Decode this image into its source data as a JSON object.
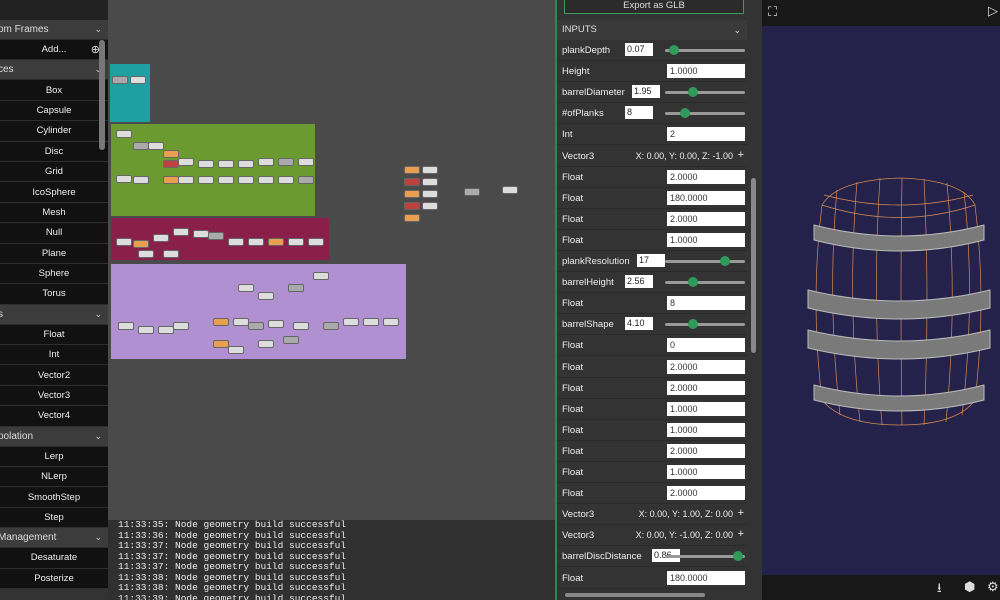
{
  "sidebar": {
    "sections": [
      {
        "title": "om Frames",
        "items": [
          {
            "label": "Add...",
            "icon": "plus-circle-icon"
          }
        ]
      },
      {
        "title": "ces",
        "items": [
          {
            "label": "Box"
          },
          {
            "label": "Capsule"
          },
          {
            "label": "Cylinder"
          },
          {
            "label": "Disc"
          },
          {
            "label": "Grid"
          },
          {
            "label": "IcoSphere"
          },
          {
            "label": "Mesh"
          },
          {
            "label": "Null"
          },
          {
            "label": "Plane"
          },
          {
            "label": "Sphere"
          },
          {
            "label": "Torus"
          }
        ]
      },
      {
        "title": "s",
        "items": [
          {
            "label": "Float"
          },
          {
            "label": "Int"
          },
          {
            "label": "Vector2"
          },
          {
            "label": "Vector3"
          },
          {
            "label": "Vector4"
          }
        ]
      },
      {
        "title": "polation",
        "items": [
          {
            "label": "Lerp"
          },
          {
            "label": "NLerp"
          },
          {
            "label": "SmoothStep"
          },
          {
            "label": "Step"
          }
        ]
      },
      {
        "title": "Management",
        "items": [
          {
            "label": "Desaturate"
          },
          {
            "label": "Posterize"
          }
        ]
      }
    ]
  },
  "console": {
    "logs": [
      "11:33:35: Node geometry build successful",
      "11:33:36: Node geometry build successful",
      "11:33:37: Node geometry build successful",
      "11:33:37: Node geometry build successful",
      "11:33:37: Node geometry build successful",
      "11:33:38: Node geometry build successful",
      "11:33:38: Node geometry build successful",
      "11:33:39: Node geometry build successful"
    ]
  },
  "inputs": {
    "export_label": "Export as GLB",
    "header": "INPUTS",
    "rows": [
      {
        "type": "slider",
        "label": "plankDepth",
        "value": "0.07",
        "level": 0.05
      },
      {
        "type": "field",
        "label": "Height",
        "value": "1.0000"
      },
      {
        "type": "slider",
        "label": "barrelDiameter",
        "value": "1.95",
        "level": 0.33
      },
      {
        "type": "slider",
        "label": "#ofPlanks",
        "value": "8",
        "level": 0.22
      },
      {
        "type": "field",
        "label": "Int",
        "value": "2"
      },
      {
        "type": "vector",
        "label": "Vector3",
        "value": "X: 0.00, Y: 0.00, Z: -1.00"
      },
      {
        "type": "field",
        "label": "Float",
        "value": "2.0000"
      },
      {
        "type": "field",
        "label": "Float",
        "value": "180.0000"
      },
      {
        "type": "field",
        "label": "Float",
        "value": "2.0000"
      },
      {
        "type": "field",
        "label": "Float",
        "value": "1.0000"
      },
      {
        "type": "slider",
        "label": "plankResolution",
        "value": "17",
        "level": 0.78
      },
      {
        "type": "slider",
        "label": "barrelHeight",
        "value": "2.56",
        "level": 0.33
      },
      {
        "type": "field",
        "label": "Float",
        "value": "8"
      },
      {
        "type": "slider",
        "label": "barrelShape",
        "value": "4.10",
        "level": 0.33
      },
      {
        "type": "field",
        "label": "Float",
        "value": "0"
      },
      {
        "type": "field",
        "label": "Float",
        "value": "2.0000"
      },
      {
        "type": "field",
        "label": "Float",
        "value": "2.0000"
      },
      {
        "type": "field",
        "label": "Float",
        "value": "1.0000"
      },
      {
        "type": "field",
        "label": "Float",
        "value": "1.0000"
      },
      {
        "type": "field",
        "label": "Float",
        "value": "2.0000"
      },
      {
        "type": "field",
        "label": "Float",
        "value": "1.0000"
      },
      {
        "type": "field",
        "label": "Float",
        "value": "2.0000"
      },
      {
        "type": "vector",
        "label": "Vector3",
        "value": "X: 0.00, Y: 1.00, Z: 0.00"
      },
      {
        "type": "vector",
        "label": "Vector3",
        "value": "X: 0.00, Y: -1.00, Z: 0.00"
      },
      {
        "type": "slider",
        "label": "barrelDiscDistance",
        "value": "0.86",
        "level": 0.97
      },
      {
        "type": "field",
        "label": "Float",
        "value": "180.0000"
      }
    ]
  },
  "viewport": {
    "icons": [
      "fullscreen-icon",
      "play-icon",
      "export-icon",
      "cube-icon",
      "settings-icon"
    ]
  },
  "colors": {
    "accent_green": "#2f9a5a",
    "frame_teal": "#1fa0a0",
    "frame_green": "#6a9a30",
    "frame_maroon": "#8a1f4a",
    "frame_purple": "#b090d0",
    "viewport_bg": "#24224a"
  }
}
